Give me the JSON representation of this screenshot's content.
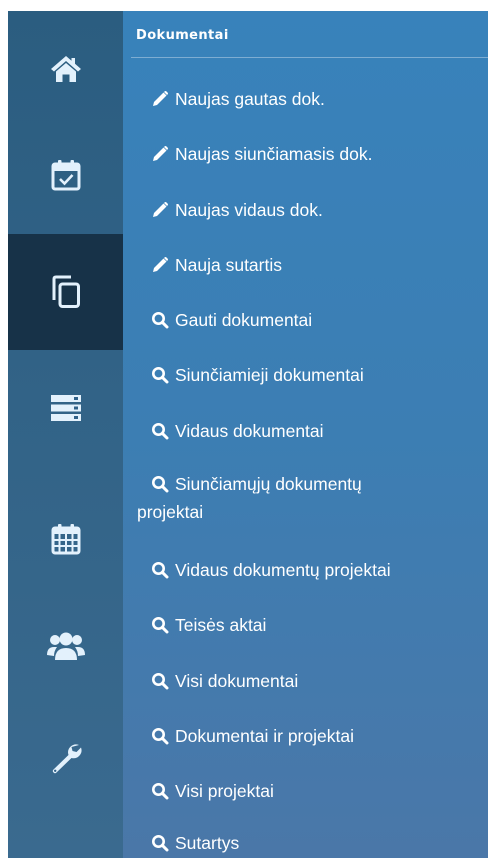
{
  "rail": {
    "items": [
      {
        "icon": "home-icon",
        "active": false
      },
      {
        "icon": "calendar-check-icon",
        "active": false
      },
      {
        "icon": "documents-icon",
        "active": true
      },
      {
        "icon": "list-stack-icon",
        "active": false
      },
      {
        "icon": "calendar-grid-icon",
        "active": false
      },
      {
        "icon": "users-icon",
        "active": false
      },
      {
        "icon": "wrench-icon",
        "active": false
      }
    ]
  },
  "panel": {
    "title": "Dokumentai",
    "items": [
      {
        "icon": "pencil-icon",
        "label": "Naujas gautas dok."
      },
      {
        "icon": "pencil-icon",
        "label": "Naujas siunčiamasis dok."
      },
      {
        "icon": "pencil-icon",
        "label": "Naujas vidaus dok."
      },
      {
        "icon": "pencil-icon",
        "label": "Nauja sutartis"
      },
      {
        "icon": "search-icon",
        "label": "Gauti dokumentai"
      },
      {
        "icon": "search-icon",
        "label": "Siunčiamieji dokumentai"
      },
      {
        "icon": "search-icon",
        "label": "Vidaus dokumentai"
      },
      {
        "icon": "search-icon",
        "label": "Siunčiamųjų dokumentų",
        "label2": "projektai"
      },
      {
        "icon": "search-icon",
        "label": "Vidaus dokumentų projektai"
      },
      {
        "icon": "search-icon",
        "label": "Teisės aktai"
      },
      {
        "icon": "search-icon",
        "label": "Visi dokumentai"
      },
      {
        "icon": "search-icon",
        "label": "Dokumentai ir projektai"
      },
      {
        "icon": "search-icon",
        "label": "Visi projektai"
      },
      {
        "icon": "search-icon",
        "label": "Sutartys"
      }
    ]
  },
  "colors": {
    "rail_bg": "#2b5d80",
    "rail_active": "#173248",
    "panel_bg": "#3882bb",
    "icon_light": "#dbeeff"
  }
}
